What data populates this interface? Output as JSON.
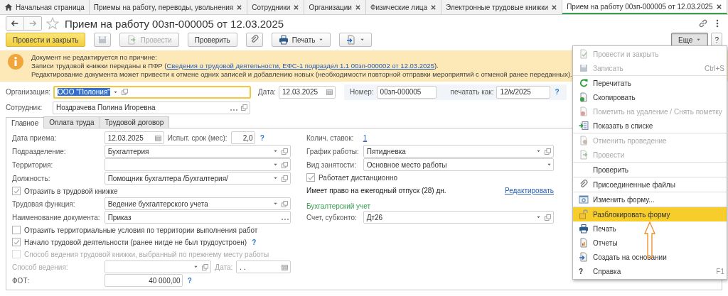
{
  "tabs": [
    {
      "label": "Начальная страница",
      "selected": false,
      "closable": false
    },
    {
      "label": "Приемы на работу, переводы, увольнения",
      "selected": false,
      "closable": true
    },
    {
      "label": "Сотрудники",
      "selected": false,
      "closable": true
    },
    {
      "label": "Организации",
      "selected": false,
      "closable": true
    },
    {
      "label": "Физические лица",
      "selected": false,
      "closable": true
    },
    {
      "label": "Электронные трудовые книжки",
      "selected": false,
      "closable": true
    },
    {
      "label": "Прием на работу 00зп-000005 от 12.03.2025",
      "selected": true,
      "closable": true
    }
  ],
  "title": "Прием на работу 00зп-000005 от 12.03.2025",
  "toolbar": [
    {
      "kind": "primary",
      "label": "Провести и закрыть",
      "disabled": false,
      "pressed": false
    },
    {
      "kind": "icon",
      "disabled": true,
      "pressed": false
    },
    {
      "kind": "icon_text",
      "label": "Провести",
      "disabled": true,
      "pressed": false
    },
    {
      "kind": "text",
      "label": "Проверить",
      "disabled": false,
      "pressed": false
    },
    {
      "kind": "icon",
      "disabled": false,
      "pressed": false
    },
    {
      "kind": "icon_menu",
      "label": "Печать",
      "disabled": false,
      "pressed": false
    },
    {
      "kind": "icon_menu",
      "disabled": false,
      "pressed": false
    }
  ],
  "toolbar_right": [
    {
      "kind": "menu",
      "label": "Еще",
      "pressed": true
    },
    {
      "kind": "text",
      "label": "?",
      "pressed": false
    }
  ],
  "notice": {
    "title": "Документ не редактируется по причине:",
    "reason": {
      "text": "Записи трудовой книжки переданы в ПФР (",
      "link": "Сведения о трудовой деятельности, ЕФС-1 подраздел 1.1 00зп-000002 от 12.03.2025",
      "after": ")."
    },
    "warning": "Редактирование документа может привести к отмене одних записей и добавлению новых (необходимости повторной отправки мероприятий с отменой ранее переданных)."
  },
  "header": {
    "organization": {
      "label": "Организация:",
      "kind": "select",
      "value": "ООО \"Полония\"",
      "focused": true
    },
    "date": {
      "label": "Дата:",
      "kind": "date",
      "value": "12.03.2025"
    },
    "number": {
      "label": "Номер:",
      "value": "00зп-000005"
    },
    "print_as": {
      "label": "печатать как:",
      "value": "12/к/2025",
      "help": "?"
    },
    "employee": {
      "label": "Сотрудник:",
      "kind": "lookup",
      "value": "Ноздрачева Полина Игоревна"
    }
  },
  "form_tabs": [
    {
      "label": "Главное",
      "selected": true
    },
    {
      "label": "Оплата труда",
      "selected": false
    },
    {
      "label": "Трудовой договор",
      "selected": false
    }
  ],
  "left": [
    {
      "kind": "date",
      "label": "Дата приема:",
      "value": "12.03.2025",
      "disabled": false,
      "extra": {
        "label": "Испыт. срок (мес):",
        "kind": "number",
        "value": "2,0",
        "help": "?"
      }
    },
    {
      "kind": "select",
      "label": "Подразделение:",
      "value": "Бухгалтерия",
      "disabled": false
    },
    {
      "kind": "select",
      "label": "Территория:",
      "disabled": false
    },
    {
      "kind": "select",
      "label": "Должность:",
      "value": "Помощник бухгалтера /Бухгалтерия/",
      "disabled": false
    },
    {
      "kind": "checkbox",
      "label": "Отразить в трудовой книжке",
      "checked": true,
      "disabled": false
    },
    {
      "kind": "select",
      "label": "Трудовая функция:",
      "value": "Ведение бухгалтерского учета",
      "disabled": false
    },
    {
      "kind": "choice",
      "label": "Наименование документа:",
      "value": "Приказ",
      "disabled": false
    },
    {
      "kind": "checkbox",
      "label": "Отразить территориальные условия по территории выполнения работ",
      "checked": false,
      "disabled": false
    },
    {
      "kind": "checkbox",
      "label": "Начало трудовой деятельности (ранее нигде не был трудоустроен)",
      "checked": true,
      "disabled": false,
      "help": "?"
    },
    {
      "kind": "checkbox",
      "label": "Способ ведения трудовой книжки, выбранный по прежнему месту работы",
      "checked": false,
      "disabled": true
    },
    {
      "kind": "select",
      "label": "Способ ведения:",
      "disabled": true,
      "extra": {
        "label": "Дата:",
        "kind": "date",
        "value": ". ."
      }
    },
    {
      "kind": "number",
      "label": "ФОТ:",
      "value": "40 000,00",
      "help": "?",
      "disabled": false
    }
  ],
  "right": [
    {
      "kind": "link",
      "label": "Колич. ставок:",
      "value": "1"
    },
    {
      "kind": "select",
      "label": "График работы:",
      "value": "Пятидневка"
    },
    {
      "kind": "dropdown",
      "label": "Вид занятости:",
      "value": "Основное место работы"
    },
    {
      "kind": "checkbox",
      "label": "Работает дистанционно",
      "checked": true
    },
    {
      "kind": "note",
      "text": "Имеет право на ежегодный отпуск (28) дн.",
      "link": "Редактировать"
    },
    {
      "kind": "section",
      "text": "Бухгалтерский учет"
    },
    {
      "kind": "select",
      "label": "Счет, субконто:",
      "value": "Дт26"
    }
  ],
  "more_menu": {
    "groups": [
      {
        "items": [
          {
            "label": "Провести и закрыть",
            "disabled": true,
            "selected": false
          },
          {
            "label": "Записать",
            "shortcut": "Ctrl+S",
            "disabled": true,
            "selected": false
          }
        ]
      },
      {
        "items": [
          {
            "label": "Перечитать",
            "disabled": false,
            "selected": false
          },
          {
            "label": "Скопировать",
            "disabled": false,
            "selected": false
          },
          {
            "label": "Пометить на удаление / Снять пометку",
            "disabled": true,
            "selected": false
          },
          {
            "label": "Показать в списке",
            "disabled": false,
            "selected": false
          }
        ]
      },
      {
        "items": [
          {
            "label": "Отменить проведение",
            "disabled": true,
            "selected": false
          },
          {
            "label": "Провести",
            "disabled": true,
            "selected": false
          }
        ]
      },
      {
        "items": [
          {
            "label": "Проверить",
            "disabled": false,
            "selected": false
          }
        ]
      },
      {
        "items": [
          {
            "label": "Присоединенные файлы",
            "disabled": false,
            "selected": false
          }
        ]
      },
      {
        "items": [
          {
            "label": "Изменить форму...",
            "disabled": false,
            "selected": false
          }
        ]
      },
      {
        "items": [
          {
            "label": "Разблокировать форму",
            "disabled": false,
            "selected": true
          },
          {
            "label": "Печать",
            "disabled": false,
            "selected": false
          },
          {
            "label": "Отчеты",
            "disabled": false,
            "selected": false
          },
          {
            "label": "Создать на основании",
            "disabled": false,
            "selected": false
          },
          {
            "label": "Справка",
            "glyph": "?",
            "shortcut": "F1",
            "disabled": false,
            "selected": false
          }
        ]
      }
    ]
  }
}
